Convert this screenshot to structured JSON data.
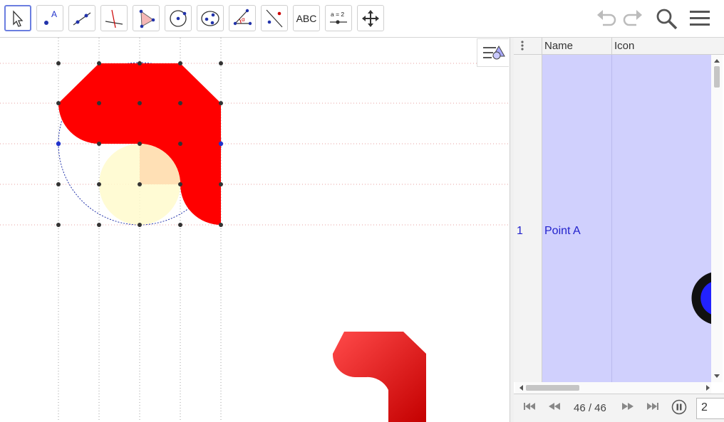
{
  "toolbar": {
    "tools": [
      {
        "name": "move-tool",
        "label": ""
      },
      {
        "name": "point-tool",
        "label": "A"
      },
      {
        "name": "line-tool",
        "label": ""
      },
      {
        "name": "perpendicular-tool",
        "label": ""
      },
      {
        "name": "polygon-tool",
        "label": ""
      },
      {
        "name": "circle-tool",
        "label": ""
      },
      {
        "name": "ellipse-tool",
        "label": ""
      },
      {
        "name": "angle-tool",
        "label": "α"
      },
      {
        "name": "reflect-tool",
        "label": ""
      },
      {
        "name": "text-tool",
        "label": "ABC"
      },
      {
        "name": "slider-tool",
        "label": "a = 2"
      },
      {
        "name": "move-graphics-view-tool",
        "label": ""
      }
    ],
    "right_icons": [
      "undo-icon",
      "redo-icon",
      "search-icon",
      "menu-icon"
    ]
  },
  "spreadsheet": {
    "columns": [
      "Name",
      "Icon"
    ],
    "rows": [
      {
        "num": "1",
        "name": "Point A"
      }
    ]
  },
  "player": {
    "counter": "46 / 46",
    "step": "2"
  },
  "colors": {
    "shape": "#ff0000",
    "circle_fill": "#fffacd",
    "cell_highlight": "#d0d0fd",
    "accent": "#6b7ee0"
  }
}
